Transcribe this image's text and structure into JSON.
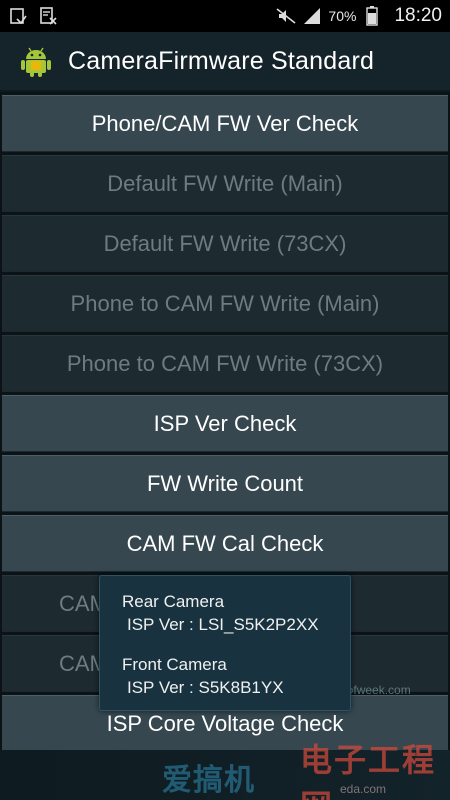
{
  "status_bar": {
    "icons_left": [
      "notification-icon",
      "screenshot-icon"
    ],
    "icons_right": [
      "mute-icon",
      "signal-icon",
      "battery-icon"
    ],
    "battery_percent": "70%",
    "time": "18:20"
  },
  "action_bar": {
    "title": "CameraFirmware Standard",
    "icon": "android-icon"
  },
  "buttons": [
    {
      "label": "Phone/CAM FW Ver Check",
      "enabled": true
    },
    {
      "label": "Default FW Write (Main)",
      "enabled": false
    },
    {
      "label": "Default FW Write (73CX)",
      "enabled": false
    },
    {
      "label": "Phone to CAM FW Write (Main)",
      "enabled": false
    },
    {
      "label": "Phone to CAM FW Write (73CX)",
      "enabled": false
    },
    {
      "label": "ISP Ver Check",
      "enabled": true
    },
    {
      "label": "FW Write Count",
      "enabled": true
    },
    {
      "label": "CAM FW Cal Check",
      "enabled": true
    },
    {
      "label": "CAM",
      "enabled": false
    },
    {
      "label": "CAM",
      "enabled": false
    },
    {
      "label": "ISP Core Voltage Check",
      "enabled": true
    }
  ],
  "dialog": {
    "rear_heading": "Rear Camera",
    "rear_value": "ISP Ver : LSI_S5K2P2XX",
    "front_heading": "Front Camera",
    "front_value": "ISP Ver : S5K8B1YX"
  },
  "colors": {
    "action_bar_bg": "#15242a",
    "button_enabled_bg": "#36474f",
    "button_disabled_bg": "#1d2a30",
    "dialog_bg": "#18333f"
  },
  "watermark": {
    "logo": "爱搞机",
    "right_text": "电子工程网",
    "site": "ee.ofweek.com",
    "site2": "eda.com"
  }
}
